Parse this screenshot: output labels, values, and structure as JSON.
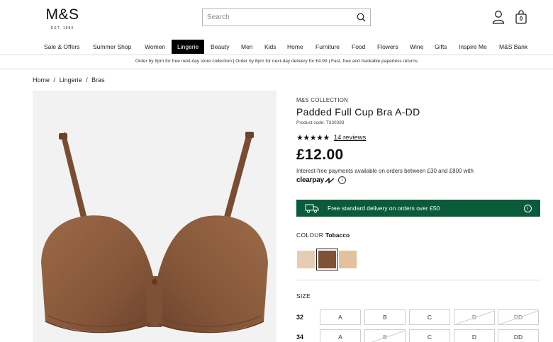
{
  "header": {
    "logo": "M&S",
    "logo_sub": "EST. 1884",
    "search_placeholder": "Search",
    "bag_count": "0"
  },
  "nav": [
    "Sale & Offers",
    "Summer Shop",
    "Women",
    "Lingerie",
    "Beauty",
    "Men",
    "Kids",
    "Home",
    "Furniture",
    "Food",
    "Flowers",
    "Wine",
    "Gifts",
    "Inspire Me",
    "M&S Bank"
  ],
  "nav_active": "Lingerie",
  "promo": "Order by 8pm for free next-day store collection  |  Order by 8pm for next-day delivery for £4.99  |  Fast, free and trackable paperless returns",
  "breadcrumb": [
    "Home",
    "/",
    "Lingerie",
    "/",
    "Bras"
  ],
  "product": {
    "brand": "M&S COLLECTION",
    "title": "Padded Full Cup Bra A-DD",
    "code": "Product code: T330393",
    "stars": "★★★★★",
    "rating": 5,
    "reviews": "14 reviews",
    "price": "£12.00",
    "clearpay_text": "Interest-free payments available on orders between £30 and £800 with",
    "clearpay_logo": "clearpay",
    "clearpay_info": "i",
    "delivery_text": "Free standard delivery on orders over £50",
    "delivery_info": "i",
    "colour_label": "COLOUR",
    "colour_value": "Tobacco",
    "swatches": [
      "#e5cdb3",
      "#7f5238",
      "#e5c09e"
    ],
    "brand_green": "#0a5b3c",
    "product_color": "#8a5a3c"
  },
  "sizes": {
    "label": "SIZE",
    "rows": [
      {
        "band": "32",
        "cups": [
          "A",
          "B",
          "C",
          "D",
          "DD"
        ],
        "unavailable": [
          false,
          false,
          false,
          true,
          true
        ]
      },
      {
        "band": "34",
        "cups": [
          "A",
          "B",
          "C",
          "D",
          "DD"
        ],
        "unavailable": [
          false,
          true,
          false,
          false,
          false
        ]
      }
    ]
  }
}
